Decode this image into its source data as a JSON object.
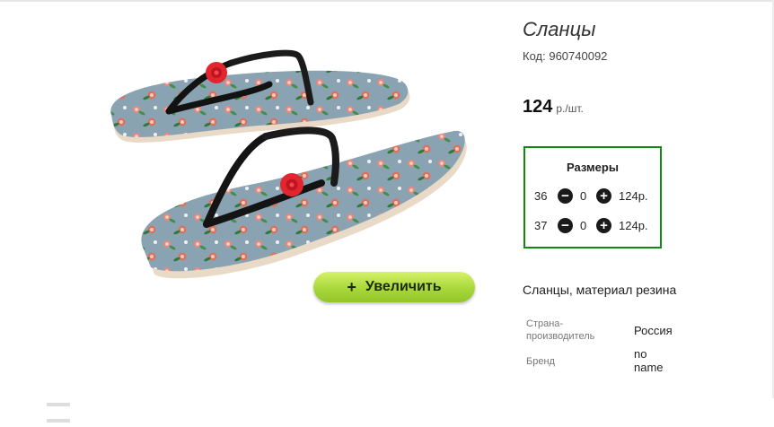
{
  "product": {
    "title": "Сланцы",
    "code_label": "Код:",
    "code_value": "960740092",
    "price_value": "124",
    "price_unit": "р./шт.",
    "description": "Сланцы, материал резина"
  },
  "zoom": {
    "icon": "plus-icon",
    "plus_glyph": "+",
    "label": "Увеличить"
  },
  "sizes": {
    "title": "Размеры",
    "rows": [
      {
        "size": "36",
        "qty": "0",
        "price": "124р."
      },
      {
        "size": "37",
        "qty": "0",
        "price": "124р."
      }
    ],
    "minus_glyph": "−",
    "plus_glyph": "+",
    "border_color": "#0f8a0f"
  },
  "specs": {
    "country_label_line1": "Страна-",
    "country_label_line2": "производитель",
    "country_value": "Россия",
    "brand_label": "Бренд",
    "brand_value_line1": "no",
    "brand_value_line2": "name"
  },
  "colors": {
    "zoom_button": "#a8d83a",
    "sizes_border": "#0f8a0f",
    "sole": "#7f9aab"
  }
}
